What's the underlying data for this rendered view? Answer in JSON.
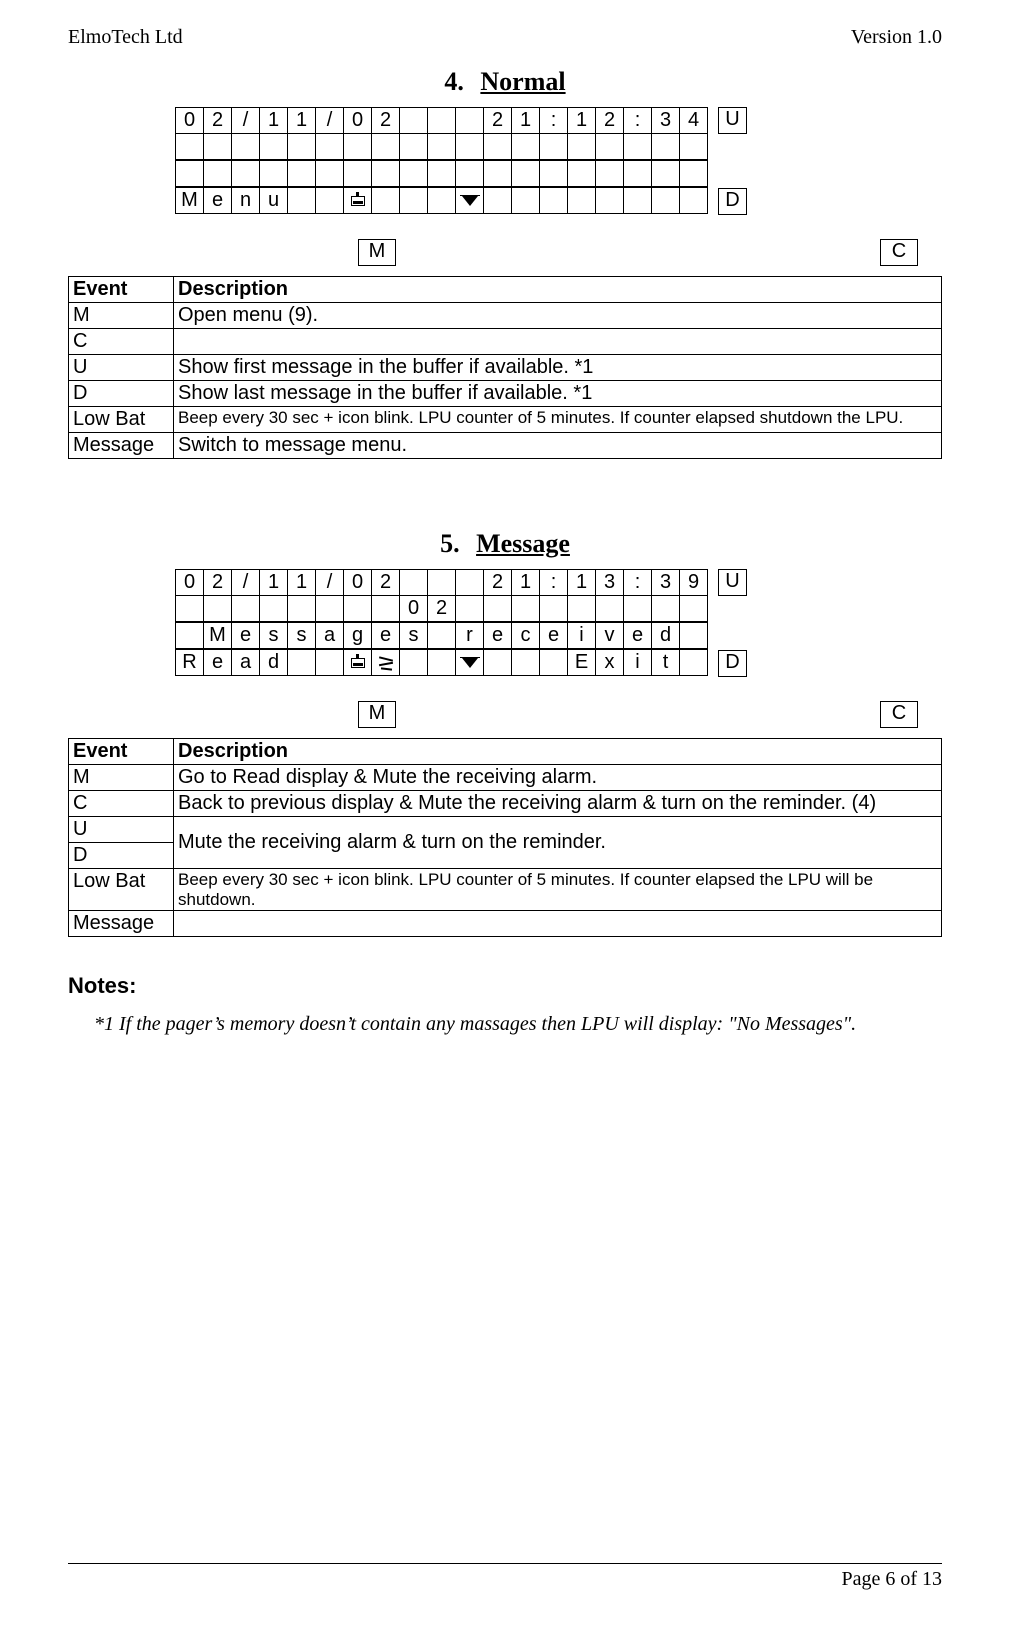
{
  "doc": {
    "company": "ElmoTech Ltd",
    "version": "Version 1.0",
    "page_label": "Page 6 of 13"
  },
  "section4": {
    "number": "4.",
    "title": "Normal",
    "btnM": "M",
    "btnC": "C",
    "sideU": "U",
    "sideD": "D",
    "lcd": {
      "r0": [
        "0",
        "2",
        "/",
        "1",
        "1",
        "/",
        "0",
        "2",
        "",
        "",
        "",
        "2",
        "1",
        ":",
        "1",
        "2",
        ":",
        "3",
        "4"
      ],
      "r1": [
        "",
        "",
        "",
        "",
        "",
        "",
        "",
        "",
        "",
        "",
        "",
        "",
        "",
        "",
        "",
        "",
        "",
        "",
        ""
      ],
      "r2": [
        "",
        "",
        "",
        "",
        "",
        "",
        "",
        "",
        "",
        "",
        "",
        "",
        "",
        "",
        "",
        "",
        "",
        "",
        ""
      ],
      "r3": [
        "M",
        "e",
        "n",
        "u",
        "",
        "",
        "",
        "",
        "",
        "",
        "",
        "",
        "",
        "",
        "",
        "",
        "",
        "",
        ""
      ]
    },
    "table": {
      "h_event": "Event",
      "h_desc": "Description",
      "rows": [
        {
          "e": "M",
          "d": "Open menu (9)."
        },
        {
          "e": "C",
          "d": ""
        },
        {
          "e": "U",
          "d": "Show first message in the buffer if available. *1"
        },
        {
          "e": "D",
          "d": "Show last message in the buffer if available. *1"
        },
        {
          "e": "Low Bat",
          "d": "Beep every 30 sec + icon blink. LPU counter of 5 minutes. If counter elapsed shutdown the LPU."
        },
        {
          "e": "Message",
          "d": "Switch to message menu."
        }
      ]
    }
  },
  "section5": {
    "number": "5.",
    "title": "Message",
    "btnM": "M",
    "btnC": "C",
    "sideU": "U",
    "sideD": "D",
    "lcd": {
      "r0": [
        "0",
        "2",
        "/",
        "1",
        "1",
        "/",
        "0",
        "2",
        "",
        "",
        "",
        "2",
        "1",
        ":",
        "1",
        "3",
        ":",
        "3",
        "9"
      ],
      "r1": [
        "",
        "",
        "",
        "",
        "",
        "",
        "",
        "",
        "0",
        "2",
        "",
        "",
        "",
        "",
        "",
        "",
        "",
        "",
        ""
      ],
      "r2": [
        "",
        "M",
        "e",
        "s",
        "s",
        "a",
        "g",
        "e",
        "s",
        "",
        "r",
        "e",
        "c",
        "e",
        "i",
        "v",
        "e",
        "d",
        ""
      ],
      "r3": [
        "R",
        "e",
        "a",
        "d",
        "",
        "",
        "",
        "",
        "",
        "",
        "",
        "",
        "",
        "",
        "E",
        "x",
        "i",
        "t",
        ""
      ]
    },
    "table": {
      "h_event": "Event",
      "h_desc": "Description",
      "M": {
        "e": "M",
        "d": "Go to Read display & Mute the receiving alarm."
      },
      "C": {
        "e": "C",
        "d": "Back to previous display & Mute the receiving alarm & turn on the reminder. (4)"
      },
      "U": {
        "e": "U"
      },
      "D": {
        "e": "D"
      },
      "UD_d": "Mute the receiving alarm & turn on the reminder.",
      "LowBat": {
        "e": "Low Bat",
        "d": "Beep every 30 sec + icon blink. LPU counter of 5 minutes. If counter elapsed the LPU will be shutdown."
      },
      "Message": {
        "e": "Message",
        "d": ""
      }
    }
  },
  "notes": {
    "heading": "Notes:",
    "n1": "*1 If the pager’s memory doesn’t contain any massages then LPU will display: \"No Messages\"."
  }
}
